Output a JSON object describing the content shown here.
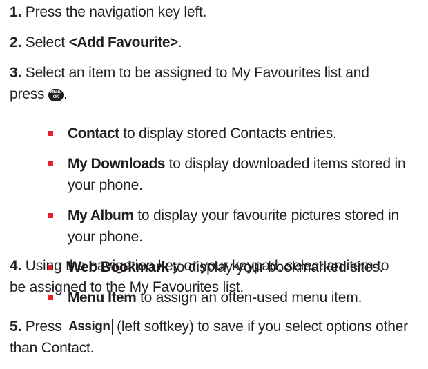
{
  "steps": [
    {
      "number": "1.",
      "text": "Press the navigation key left."
    },
    {
      "number": "2.",
      "pre": "Select ",
      "bold": "<Add Favourite>",
      "post": "."
    },
    {
      "number": "3.",
      "line1": "Select an item to be assigned to My Favourites list and",
      "line2_pre": "press ",
      "icon": {
        "name": "menu-ok-key-icon",
        "top": "MENU",
        "bottom": "OK"
      },
      "line2_post": "."
    },
    {
      "number": "4.",
      "line1": "Using the navigation key or your keypad, select an item to",
      "line2": "be assigned to the My Favourites list."
    },
    {
      "number": "5.",
      "pre": "Press ",
      "softkey": "Assign",
      "post": " (left softkey) to save if you select options other",
      "line2": "than Contact."
    }
  ],
  "bullets": [
    {
      "bold": "Contact",
      "text": " to display stored Contacts entries."
    },
    {
      "bold": "My Downloads",
      "text": " to display downloaded items stored in",
      "line2": "your phone."
    },
    {
      "bold": "My Album",
      "text": " to display your favourite pictures stored in",
      "line2": "your phone."
    },
    {
      "bold": "Web Bookmark",
      "text": " to display your bookmarked sites."
    },
    {
      "bold": "Menu Item",
      "text": " to assign an often-used menu item."
    }
  ],
  "colors": {
    "text": "#231f20",
    "bullet": "#e8202a"
  }
}
